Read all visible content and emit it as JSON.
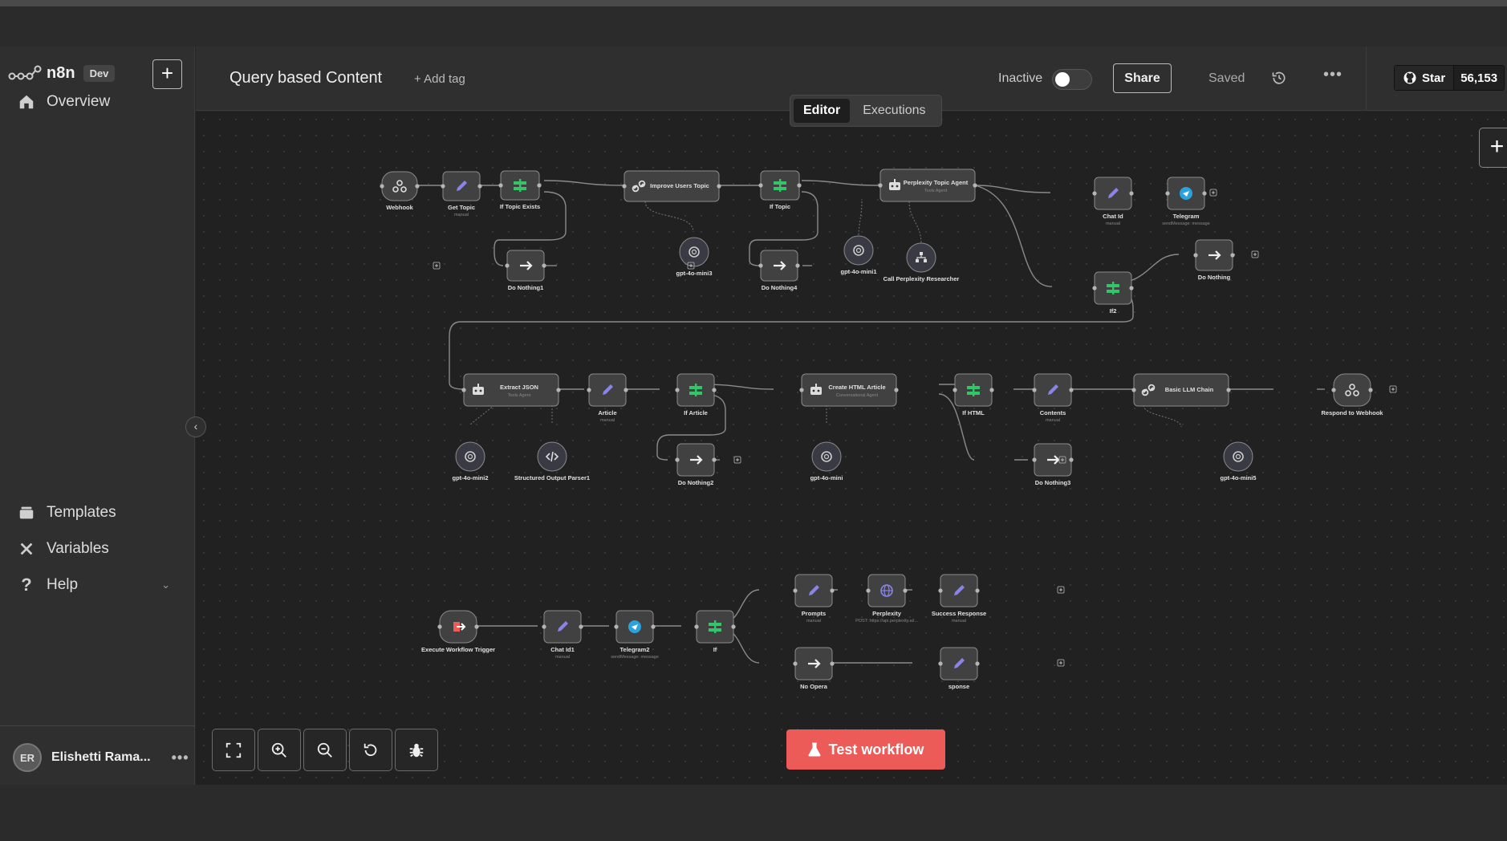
{
  "app": {
    "logo_text": "n8n",
    "badge": "Dev"
  },
  "sidebar": {
    "overview": "Overview",
    "templates": "Templates",
    "variables": "Variables",
    "help": "Help",
    "user_name": "Elishetti Rama...",
    "user_initials": "ER"
  },
  "header": {
    "workflow_name": "Query based Content",
    "add_tag": "+ Add tag",
    "status": "Inactive",
    "share": "Share",
    "saved": "Saved",
    "github_star": "Star",
    "github_count": "56,153"
  },
  "tabs": {
    "editor": "Editor",
    "executions": "Executions"
  },
  "test_button": "Test workflow",
  "nodes": [
    {
      "id": "webhook",
      "label": "Webhook",
      "sub": "",
      "icon": "webhook-icon"
    },
    {
      "id": "get-topic",
      "label": "Get Topic",
      "sub": "manual",
      "icon": "pencil-icon"
    },
    {
      "id": "if-topic-exists",
      "label": "If Topic Exists",
      "sub": "",
      "icon": "if-icon"
    },
    {
      "id": "improve-users-topic",
      "label": "Improve Users Topic",
      "sub": "",
      "icon": "chain-icon"
    },
    {
      "id": "gpt-4o-mini3",
      "label": "gpt-4o-mini3",
      "sub": "",
      "icon": "openai-icon"
    },
    {
      "id": "if-topic",
      "label": "If Topic",
      "sub": "",
      "icon": "if-icon"
    },
    {
      "id": "perplexity-topic-agent",
      "label": "Perplexity Topic Agent",
      "sub": "Tools Agent",
      "icon": "robot-icon"
    },
    {
      "id": "gpt-4o-mini1",
      "label": "gpt-4o-mini1",
      "sub": "",
      "icon": "openai-icon"
    },
    {
      "id": "call-perplexity-researcher",
      "label": "Call Perplexity Researcher",
      "sub": "",
      "icon": "sitemap-icon"
    },
    {
      "id": "chat-id",
      "label": "Chat Id",
      "sub": "manual",
      "icon": "pencil-icon"
    },
    {
      "id": "telegram",
      "label": "Telegram",
      "sub": "sendMessage: message",
      "icon": "telegram-icon"
    },
    {
      "id": "do-nothing1",
      "label": "Do Nothing1",
      "sub": "",
      "icon": "arrow-icon"
    },
    {
      "id": "do-nothing4",
      "label": "Do Nothing4",
      "sub": "",
      "icon": "arrow-icon"
    },
    {
      "id": "if2",
      "label": "If2",
      "sub": "",
      "icon": "if-icon"
    },
    {
      "id": "do-nothing",
      "label": "Do Nothing",
      "sub": "",
      "icon": "arrow-icon"
    },
    {
      "id": "extract-json",
      "label": "Extract JSON",
      "sub": "Tools Agent",
      "icon": "robot-icon"
    },
    {
      "id": "article",
      "label": "Article",
      "sub": "manual",
      "icon": "pencil-icon"
    },
    {
      "id": "if-article",
      "label": "If Article",
      "sub": "",
      "icon": "if-icon"
    },
    {
      "id": "create-html-article",
      "label": "Create HTML Article",
      "sub": "Conversational Agent",
      "icon": "robot-icon"
    },
    {
      "id": "if-html",
      "label": "If HTML",
      "sub": "",
      "icon": "if-icon"
    },
    {
      "id": "contents",
      "label": "Contents",
      "sub": "manual",
      "icon": "pencil-icon"
    },
    {
      "id": "basic-llm-chain",
      "label": "Basic LLM Chain",
      "sub": "",
      "icon": "chain-icon"
    },
    {
      "id": "respond-to-webhook",
      "label": "Respond to Webhook",
      "sub": "",
      "icon": "webhook-icon"
    },
    {
      "id": "gpt-4o-mini2",
      "label": "gpt-4o-mini2",
      "sub": "",
      "icon": "openai-icon"
    },
    {
      "id": "structured-output-parser1",
      "label": "Structured Output Parser1",
      "sub": "",
      "icon": "code-icon"
    },
    {
      "id": "do-nothing2",
      "label": "Do Nothing2",
      "sub": "",
      "icon": "arrow-icon"
    },
    {
      "id": "gpt-4o-mini",
      "label": "gpt-4o-mini",
      "sub": "",
      "icon": "openai-icon"
    },
    {
      "id": "do-nothing3",
      "label": "Do Nothing3",
      "sub": "",
      "icon": "arrow-icon"
    },
    {
      "id": "gpt-4o-mini5",
      "label": "gpt-4o-mini5",
      "sub": "",
      "icon": "openai-icon"
    },
    {
      "id": "execute-workflow-trigger",
      "label": "Execute Workflow Trigger",
      "sub": "",
      "icon": "trigger-icon"
    },
    {
      "id": "chat-id1",
      "label": "Chat Id1",
      "sub": "manual",
      "icon": "pencil-icon"
    },
    {
      "id": "telegram2",
      "label": "Telegram2",
      "sub": "sendMessage: message",
      "icon": "telegram-icon"
    },
    {
      "id": "if",
      "label": "If",
      "sub": "",
      "icon": "if-icon"
    },
    {
      "id": "prompts",
      "label": "Prompts",
      "sub": "manual",
      "icon": "pencil-icon"
    },
    {
      "id": "perplexity",
      "label": "Perplexity",
      "sub": "POST: https://api.perplexity.ai/...",
      "icon": "globe-icon"
    },
    {
      "id": "success-response",
      "label": "Success Response",
      "sub": "manual",
      "icon": "pencil-icon"
    },
    {
      "id": "no-operation",
      "label": "No Opera",
      "sub": "",
      "icon": "arrow-icon"
    },
    {
      "id": "error-response",
      "label": "sponse",
      "sub": "",
      "icon": "pencil-icon"
    }
  ],
  "colors": {
    "accent": "#ec5b57",
    "if_green": "#35c46a",
    "pencil_purple": "#8b84e8",
    "telegram_blue": "#2aa3dd"
  }
}
